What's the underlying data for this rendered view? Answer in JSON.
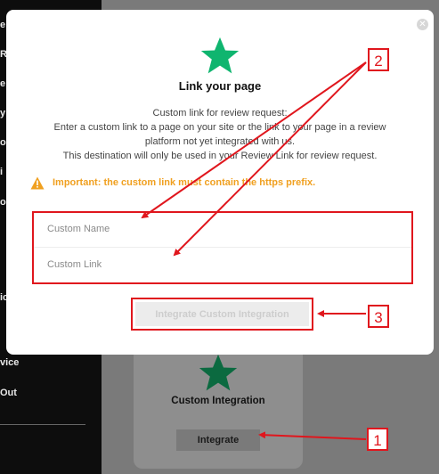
{
  "sidebar": {
    "fragments": [
      "e",
      "R",
      "e",
      "y",
      "o",
      "i",
      "o",
      "ic",
      "vice",
      "Out"
    ]
  },
  "background_card": {
    "icon": "star-icon",
    "title": "Custom Integration",
    "button_label": "Integrate"
  },
  "modal": {
    "close_icon": "close-icon",
    "icon": "star-icon",
    "title": "Link your page",
    "description_lines": [
      "Custom link for review request:",
      "Enter a custom link to a page on your site or the link to your page in a review",
      "platform not yet integrated with us.",
      "This destination will only be used in your Review Link for review request."
    ],
    "warning": "Important: the custom link must contain the https prefix.",
    "fields": {
      "name_placeholder": "Custom Name",
      "link_placeholder": "Custom Link"
    },
    "submit_label": "Integrate Custom Integration"
  },
  "annotations": [
    "1",
    "2",
    "3"
  ],
  "colors": {
    "star": "#0fb56f",
    "annotation": "#e0161d",
    "warning": "#f0a020"
  }
}
